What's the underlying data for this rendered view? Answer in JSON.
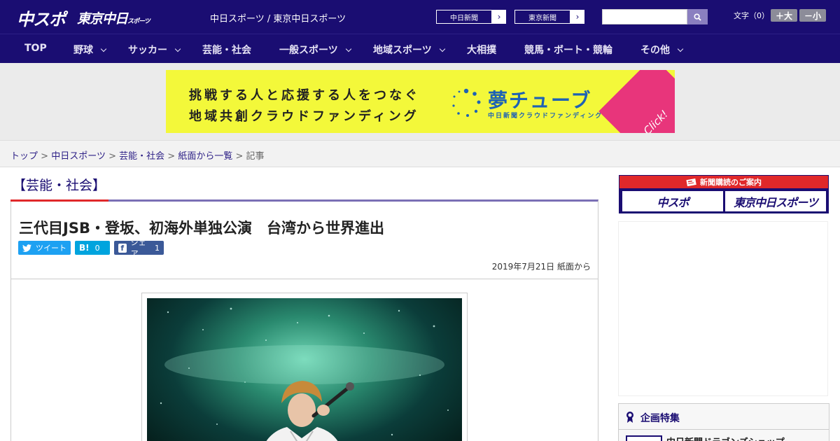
{
  "header": {
    "logo_main": "中スポ",
    "logo_tokyo": "東京中日",
    "logo_tokyo_sub": "スポーツ",
    "site_names": "中日スポーツ / 東京中日スポーツ",
    "paper_links": [
      {
        "label": "中日新聞",
        "arrow": "›"
      },
      {
        "label": "東京新聞",
        "arrow": "›"
      }
    ],
    "search": {
      "placeholder": ""
    },
    "font_size": {
      "label": "文字（0）",
      "increase": "＋大",
      "decrease": "－小"
    }
  },
  "nav": {
    "items": [
      {
        "label": "TOP"
      },
      {
        "label": "野球"
      },
      {
        "label": "サッカー"
      },
      {
        "label": "芸能・社会"
      },
      {
        "label": "一般スポーツ"
      },
      {
        "label": "地域スポーツ"
      },
      {
        "label": "大相撲"
      },
      {
        "label": "競馬・ボート・競輪"
      },
      {
        "label": "その他"
      }
    ]
  },
  "banner": {
    "line1": "挑戦する人と応援する人をつなぐ",
    "line2": "地域共創クラウドファンディング",
    "brand": "夢チューブ",
    "brand_sub": "中日新聞クラウドファンディング",
    "cta": "Click!"
  },
  "breadcrumb": {
    "items": [
      "トップ",
      "中日スポーツ",
      "芸能・社会",
      "紙面から一覧"
    ],
    "separator": ">",
    "current": "記事"
  },
  "article": {
    "category": "【芸能・社会】",
    "title": "三代目JSB・登坂、初海外単独公演　台湾から世界進出",
    "share": {
      "tweet": "ツイート",
      "hatena_mark": "B!",
      "hatena_count": "0",
      "facebook": "シェア",
      "facebook_count": "1"
    },
    "date": "2019年7月21日",
    "source": "紙面から"
  },
  "sidebar": {
    "subscription_head": "新聞購読のご案内",
    "subscription_buttons": [
      "中スポ",
      "東京中日スポーツ"
    ],
    "feature_head": "企画特集",
    "feature_item": "中日新聞ドラゴンズショップ"
  },
  "colors": {
    "brand_navy": "#1a0d72",
    "accent_red": "#e0282a",
    "twitter": "#1da1f2",
    "hatena": "#00a4de",
    "facebook": "#3b5998"
  }
}
